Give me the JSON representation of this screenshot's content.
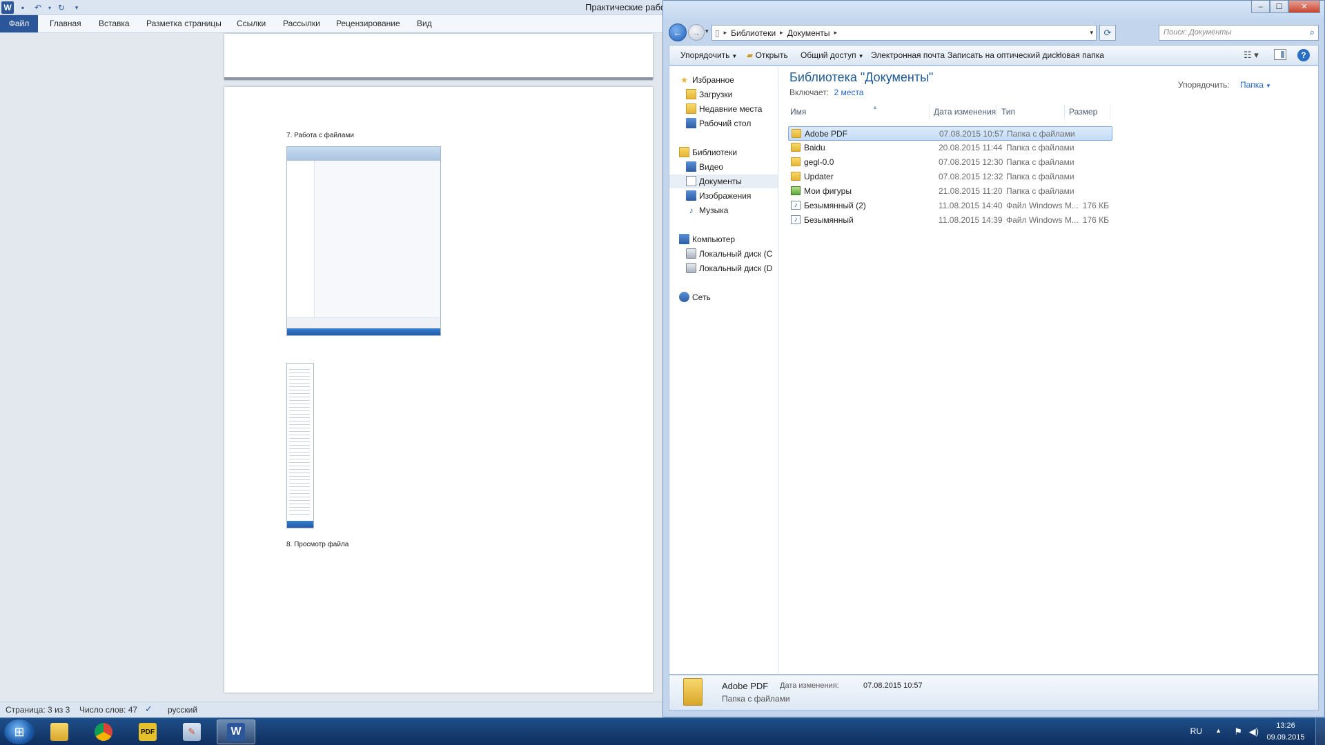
{
  "word": {
    "title": "Практические  рабо",
    "ribbon_tabs": [
      "Файл",
      "Главная",
      "Вставка",
      "Разметка страницы",
      "Ссылки",
      "Рассылки",
      "Рецензирование",
      "Вид"
    ],
    "page_text": {
      "heading7": "7. Работа с файлами",
      "heading8": "8. Просмотр  файла"
    },
    "status": {
      "page": "Страница: 3 из 3",
      "words": "Число слов: 47",
      "language": "русский"
    }
  },
  "explorer": {
    "breadcrumb": [
      "Библиотеки",
      "Документы"
    ],
    "search_placeholder": "Поиск: Документы",
    "toolbar": {
      "organize": "Упорядочить",
      "open": "Открыть",
      "share": "Общий доступ",
      "email": "Электронная почта",
      "burn": "Записать на оптический диск",
      "new_folder": "Новая папка"
    },
    "sidebar": {
      "favorites": "Избранное",
      "downloads": "Загрузки",
      "recent": "Недавние места",
      "desktop": "Рабочий стол",
      "libraries": "Библиотеки",
      "video": "Видео",
      "documents": "Документы",
      "images": "Изображения",
      "music": "Музыка",
      "computer": "Компьютер",
      "disk_c": "Локальный диск (C",
      "disk_d": "Локальный диск (D",
      "network": "Сеть"
    },
    "library_title": "Библиотека \"Документы\"",
    "includes_label": "Включает:",
    "includes_link": "2 места",
    "arrange_label": "Упорядочить:",
    "arrange_value": "Папка",
    "columns": {
      "name": "Имя",
      "date": "Дата изменения",
      "type": "Тип",
      "size": "Размер"
    },
    "files": [
      {
        "name": "Adobe PDF",
        "date": "07.08.2015 10:57",
        "type": "Папка с файлами",
        "size": "",
        "icon": "folder-icon"
      },
      {
        "name": "Baidu",
        "date": "20.08.2015 11:44",
        "type": "Папка с файлами",
        "size": "",
        "icon": "folder-icon"
      },
      {
        "name": "gegl-0.0",
        "date": "07.08.2015 12:30",
        "type": "Папка с файлами",
        "size": "",
        "icon": "folder-icon"
      },
      {
        "name": "Updater",
        "date": "07.08.2015 12:32",
        "type": "Папка с файлами",
        "size": "",
        "icon": "folder-icon"
      },
      {
        "name": "Мои фигуры",
        "date": "21.08.2015 11:20",
        "type": "Папка с файлами",
        "size": "",
        "icon": "shapes-folder-icon"
      },
      {
        "name": "Безымянный (2)",
        "date": "11.08.2015 14:40",
        "type": "Файл Windows M...",
        "size": "176 КБ",
        "icon": "media-file-icon"
      },
      {
        "name": "Безымянный",
        "date": "11.08.2015 14:39",
        "type": "Файл Windows M...",
        "size": "176 КБ",
        "icon": "media-file-icon"
      }
    ],
    "details": {
      "name": "Adobe PDF",
      "type": "Папка с файлами",
      "date_label": "Дата изменения:",
      "date": "07.08.2015 10:57"
    }
  },
  "taskbar": {
    "apps": [
      "explorer-icon",
      "chrome-icon",
      "pdf-icon",
      "paint-icon",
      "word-icon"
    ],
    "lang": "RU",
    "time": "13:26",
    "date": "09.09.2015"
  }
}
